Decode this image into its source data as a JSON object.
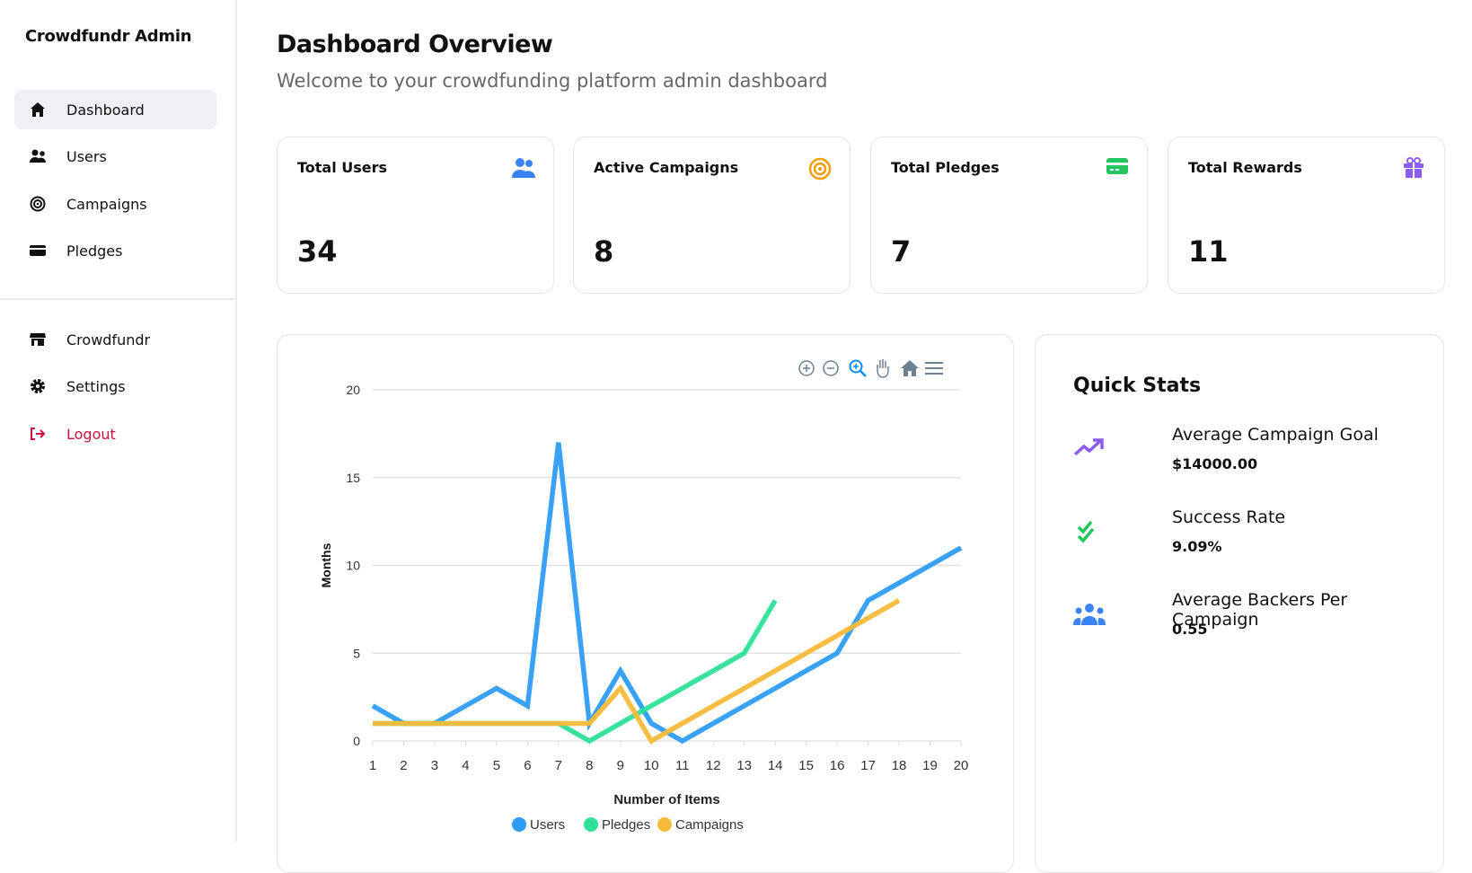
{
  "sidebar": {
    "brand": "Crowdfundr Admin",
    "items": [
      {
        "label": "Dashboard",
        "icon": "home-icon"
      },
      {
        "label": "Users",
        "icon": "users-icon"
      },
      {
        "label": "Campaigns",
        "icon": "target-icon"
      },
      {
        "label": "Pledges",
        "icon": "credit-card-icon"
      }
    ],
    "bottom_items": [
      {
        "label": "Crowdfundr",
        "icon": "store-icon"
      },
      {
        "label": "Settings",
        "icon": "gear-icon"
      },
      {
        "label": "Logout",
        "icon": "logout-icon"
      }
    ]
  },
  "header": {
    "title": "Dashboard Overview",
    "subtitle": "Welcome to your crowdfunding platform admin dashboard"
  },
  "cards": [
    {
      "label": "Total Users",
      "value": "34",
      "icon": "users-icon",
      "color": "#3b82f6"
    },
    {
      "label": "Active Campaigns",
      "value": "8",
      "icon": "bullseye-icon",
      "color": "#f59e0b"
    },
    {
      "label": "Total Pledges",
      "value": "7",
      "icon": "credit-card-icon",
      "color": "#22c55e"
    },
    {
      "label": "Total Rewards",
      "value": "11",
      "icon": "gift-icon",
      "color": "#8b5cf6"
    }
  ],
  "quick_stats": {
    "title": "Quick Stats",
    "items": [
      {
        "label": "Average Campaign Goal",
        "value": "$14000.00",
        "icon": "trend-up-icon",
        "color": "#8b5cf6"
      },
      {
        "label": "Success Rate",
        "value": "9.09%",
        "icon": "double-check-icon",
        "color": "#22c55e"
      },
      {
        "label": "Average Backers Per Campaign",
        "value": "0.55",
        "icon": "users-group-icon",
        "color": "#3b82f6"
      }
    ]
  },
  "chart_data": {
    "type": "line",
    "xlabel": "Number of Items",
    "ylabel": "Months",
    "ylim": [
      0,
      20
    ],
    "yticks": [
      0,
      5,
      10,
      15,
      20
    ],
    "x": [
      1,
      2,
      3,
      4,
      5,
      6,
      7,
      8,
      9,
      10,
      11,
      12,
      13,
      14,
      15,
      16,
      17,
      18,
      19,
      20
    ],
    "grid": true,
    "legend": "bottom",
    "series": [
      {
        "name": "Users",
        "color": "#2e9cf6",
        "values": [
          2,
          1,
          1,
          2,
          3,
          2,
          17,
          1,
          4,
          1,
          0,
          1,
          2,
          3,
          4,
          5,
          8,
          9,
          10,
          11
        ]
      },
      {
        "name": "Pledges",
        "color": "#2ee09a",
        "values": [
          1,
          1,
          1,
          1,
          1,
          1,
          1,
          0,
          1,
          2,
          3,
          4,
          5,
          8
        ]
      },
      {
        "name": "Campaigns",
        "color": "#f7b93a",
        "values": [
          1,
          1,
          1,
          1,
          1,
          1,
          1,
          1,
          3,
          0,
          1,
          2,
          3,
          4,
          5,
          6,
          7,
          8
        ]
      }
    ]
  }
}
